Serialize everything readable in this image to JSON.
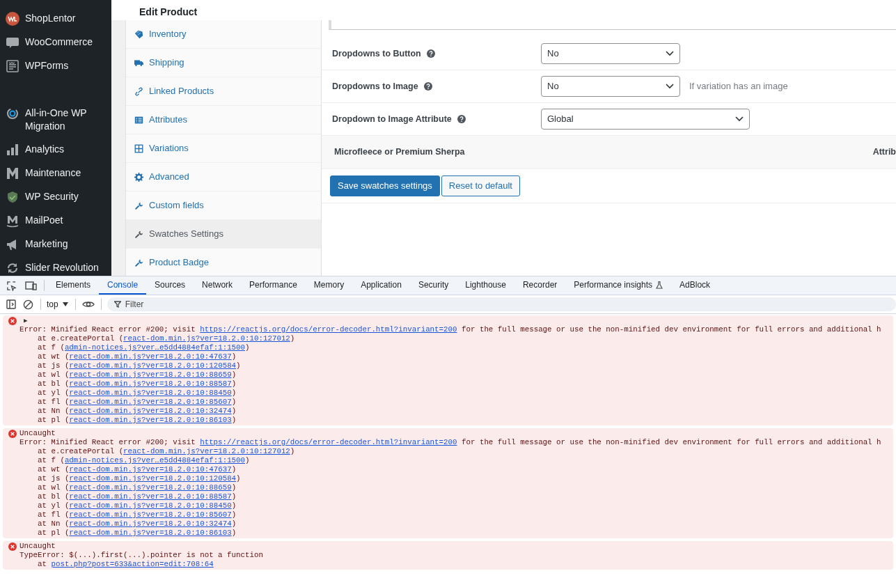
{
  "admin_menu": [
    {
      "label": "ShopLentor"
    },
    {
      "label": "WooCommerce"
    },
    {
      "label": "WPForms"
    },
    {
      "label": "All-in-One WP Migration"
    },
    {
      "label": "Analytics"
    },
    {
      "label": "Maintenance"
    },
    {
      "label": "WP Security"
    },
    {
      "label": "MailPoet"
    },
    {
      "label": "Marketing"
    },
    {
      "label": "Slider Revolution"
    }
  ],
  "page_title": "Edit Product",
  "product_tabs": [
    {
      "label": "Inventory",
      "selected": false
    },
    {
      "label": "Shipping",
      "selected": false
    },
    {
      "label": "Linked Products",
      "selected": false
    },
    {
      "label": "Attributes",
      "selected": false
    },
    {
      "label": "Variations",
      "selected": false
    },
    {
      "label": "Advanced",
      "selected": false
    },
    {
      "label": "Custom fields",
      "selected": false
    },
    {
      "label": "Swatches Settings",
      "selected": true
    },
    {
      "label": "Product Badge",
      "selected": false
    }
  ],
  "settings": [
    {
      "label": "Dropdowns to Button",
      "value": "No"
    },
    {
      "label": "Dropdowns to Image",
      "value": "No",
      "note": "If variation has an image"
    },
    {
      "label": "Dropdown to Image Attribute",
      "value": "Global"
    }
  ],
  "attribute_row": {
    "name": "Microfleece or Premium Sherpa",
    "column_2": "Attrib"
  },
  "buttons": [
    {
      "label": "Save swatches settings",
      "kind": "primary"
    },
    {
      "label": "Reset to default",
      "kind": "secondary"
    }
  ],
  "devtools": {
    "tabs": [
      {
        "label": "Elements",
        "selected": false
      },
      {
        "label": "Console",
        "selected": true
      },
      {
        "label": "Sources",
        "selected": false
      },
      {
        "label": "Network",
        "selected": false
      },
      {
        "label": "Performance",
        "selected": false
      },
      {
        "label": "Memory",
        "selected": false
      },
      {
        "label": "Application",
        "selected": false
      },
      {
        "label": "Security",
        "selected": false
      },
      {
        "label": "Lighthouse",
        "selected": false
      },
      {
        "label": "Recorder",
        "selected": false
      },
      {
        "label": "Performance insights",
        "selected": false
      },
      {
        "label": "AdBlock",
        "selected": false
      }
    ],
    "context": "top",
    "filter_placeholder": "Filter",
    "messages": [
      {
        "kind": "expandable",
        "header": "▶",
        "text": {
          "before": "Error: Minified React error #200; visit ",
          "link": "https://reactjs.org/docs/error-decoder.html?invariant=200",
          "after": " for the full message or use the non-minified dev environment for full errors and additional h"
        },
        "stack": [
          {
            "prefix": "at e.createPortal (",
            "link": "react-dom.min.js?ver=18.2.0:10:127012",
            "suffix": ")"
          },
          {
            "prefix": "at f (",
            "link": "admin-notices.js?ver…e5dd4884efaf:1:1500",
            "suffix": ")"
          },
          {
            "prefix": "at wt (",
            "link": "react-dom.min.js?ver=18.2.0:10:47637",
            "suffix": ")"
          },
          {
            "prefix": "at js (",
            "link": "react-dom.min.js?ver=18.2.0:10:120584",
            "suffix": ")"
          },
          {
            "prefix": "at wl (",
            "link": "react-dom.min.js?ver=18.2.0:10:88659",
            "suffix": ")"
          },
          {
            "prefix": "at bl (",
            "link": "react-dom.min.js?ver=18.2.0:10:88587",
            "suffix": ")"
          },
          {
            "prefix": "at yl (",
            "link": "react-dom.min.js?ver=18.2.0:10:88450",
            "suffix": ")"
          },
          {
            "prefix": "at fl (",
            "link": "react-dom.min.js?ver=18.2.0:10:85607",
            "suffix": ")"
          },
          {
            "prefix": "at Nn (",
            "link": "react-dom.min.js?ver=18.2.0:10:32474",
            "suffix": ")"
          },
          {
            "prefix": "at pl (",
            "link": "react-dom.min.js?ver=18.2.0:10:86103",
            "suffix": ")"
          }
        ]
      },
      {
        "kind": "uncaught",
        "header": "Uncaught",
        "text": {
          "before": "Error: Minified React error #200; visit ",
          "link": "https://reactjs.org/docs/error-decoder.html?invariant=200",
          "after": " for the full message or use the non-minified dev environment for full errors and additional h"
        },
        "stack": [
          {
            "prefix": "at e.createPortal (",
            "link": "react-dom.min.js?ver=18.2.0:10:127012",
            "suffix": ")"
          },
          {
            "prefix": "at f (",
            "link": "admin-notices.js?ver…e5dd4884efaf:1:1500",
            "suffix": ")"
          },
          {
            "prefix": "at wt (",
            "link": "react-dom.min.js?ver=18.2.0:10:47637",
            "suffix": ")"
          },
          {
            "prefix": "at js (",
            "link": "react-dom.min.js?ver=18.2.0:10:120584",
            "suffix": ")"
          },
          {
            "prefix": "at wl (",
            "link": "react-dom.min.js?ver=18.2.0:10:88659",
            "suffix": ")"
          },
          {
            "prefix": "at bl (",
            "link": "react-dom.min.js?ver=18.2.0:10:88587",
            "suffix": ")"
          },
          {
            "prefix": "at yl (",
            "link": "react-dom.min.js?ver=18.2.0:10:88450",
            "suffix": ")"
          },
          {
            "prefix": "at fl (",
            "link": "react-dom.min.js?ver=18.2.0:10:85607",
            "suffix": ")"
          },
          {
            "prefix": "at Nn (",
            "link": "react-dom.min.js?ver=18.2.0:10:32474",
            "suffix": ")"
          },
          {
            "prefix": "at pl (",
            "link": "react-dom.min.js?ver=18.2.0:10:86103",
            "suffix": ")"
          }
        ]
      },
      {
        "kind": "uncaught",
        "header": "Uncaught",
        "text": {
          "before": "TypeError: $(...).first(...).pointer is not a function"
        },
        "stack": [
          {
            "prefix": "at ",
            "link": "post.php?post=633&action=edit:708:64"
          }
        ]
      }
    ]
  }
}
